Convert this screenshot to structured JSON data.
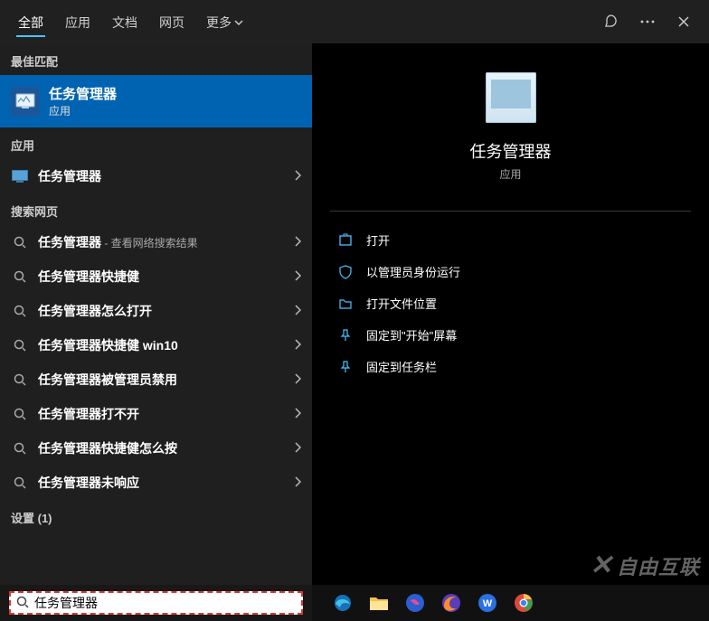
{
  "topbar": {
    "tabs": {
      "all": "全部",
      "apps": "应用",
      "docs": "文档",
      "web": "网页",
      "more": "更多"
    }
  },
  "sections": {
    "best_match": "最佳匹配",
    "apps": "应用",
    "web": "搜索网页",
    "settings": "设置 (1)"
  },
  "best": {
    "title": "任务管理器",
    "subtitle": "应用"
  },
  "app_item": {
    "label": "任务管理器"
  },
  "web_items": [
    {
      "prefix": "任务管理器",
      "suffix": " - 查看网络搜索结果"
    },
    {
      "prefix": "任务管理器快捷健",
      "suffix": ""
    },
    {
      "prefix": "任务管理器怎么打开",
      "suffix": ""
    },
    {
      "prefix": "任务管理器快捷健 win10",
      "suffix": ""
    },
    {
      "prefix": "任务管理器被管理员禁用",
      "suffix": ""
    },
    {
      "prefix": "任务管理器打不开",
      "suffix": ""
    },
    {
      "prefix": "任务管理器快捷健怎么按",
      "suffix": ""
    },
    {
      "prefix": "任务管理器未响应",
      "suffix": ""
    }
  ],
  "detail": {
    "title": "任务管理器",
    "sub": "应用",
    "actions": {
      "open": "打开",
      "admin": "以管理员身份运行",
      "open_loc": "打开文件位置",
      "pin_start": "固定到\"开始\"屏幕",
      "pin_task": "固定到任务栏"
    }
  },
  "search": {
    "value": "任务管理器"
  },
  "watermark": "自由互联"
}
